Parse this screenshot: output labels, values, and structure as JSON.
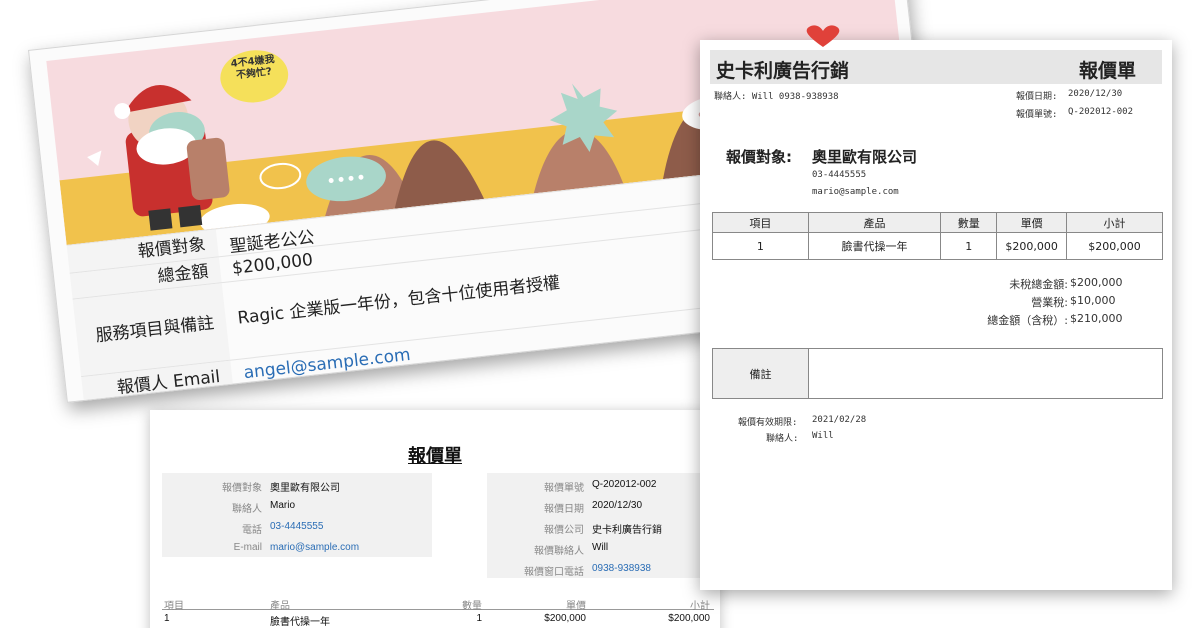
{
  "card_christmas": {
    "bubble_text_line1": "4不4嫌我",
    "bubble_text_line2": "不夠忙?",
    "fields": [
      {
        "label": "報價對象",
        "value": "聖誕老公公"
      },
      {
        "label": "總金額",
        "value": "$200,000"
      },
      {
        "label": "服務項目與備註",
        "value": "Ragic 企業版一年份，包含十位使用者授權"
      },
      {
        "label": "報價人 Email",
        "value": "angel@sample.com"
      }
    ]
  },
  "card_ragic": {
    "title": "報價單",
    "left_info": [
      {
        "label": "報價對象",
        "value": "奧里歐有限公司"
      },
      {
        "label": "聯絡人",
        "value": "Mario"
      },
      {
        "label": "電話",
        "value": "03-4445555"
      },
      {
        "label": "E-mail",
        "value": "mario@sample.com"
      }
    ],
    "right_info": [
      {
        "label": "報價單號",
        "value": "Q-202012-002"
      },
      {
        "label": "報價日期",
        "value": "2020/12/30"
      },
      {
        "label": "報價公司",
        "value": "史卡利廣告行銷"
      },
      {
        "label": "報價聯絡人",
        "value": "Will"
      },
      {
        "label": "報價窗口電話",
        "value": "0938-938938"
      }
    ],
    "table_headers": [
      "項目",
      "產品",
      "數量",
      "單價",
      "小計"
    ],
    "table_rows": [
      [
        "1",
        "臉書代操一年",
        "1",
        "$200,000",
        "$200,000"
      ]
    ]
  },
  "card_right": {
    "company": "史卡利廣告行銷",
    "doc_title": "報價單",
    "contact_line": "聯絡人: Will 0938-938938",
    "date_label": "報價日期:",
    "date_value": "2020/12/30",
    "number_label": "報價單號:",
    "number_value": "Q-202012-002",
    "target_label": "報價對象:",
    "target_value": "奧里歐有限公司",
    "target_phone": "03-4445555",
    "target_email": "mario@sample.com",
    "table_headers": [
      "項目",
      "產品",
      "數量",
      "單價",
      "小計"
    ],
    "table_rows": [
      [
        "1",
        "臉書代操一年",
        "1",
        "$200,000",
        "$200,000"
      ]
    ],
    "summary": [
      {
        "label": "未稅總金額:",
        "value": "$200,000"
      },
      {
        "label": "營業稅:",
        "value": "$10,000"
      },
      {
        "label": "總金額（含稅）:",
        "value": "$210,000"
      }
    ],
    "notes_label": "備註",
    "validity_label": "報價有效期限:",
    "validity_value": "2021/02/28",
    "footer_contact_label": "聯絡人:",
    "footer_contact_value": "Will"
  }
}
